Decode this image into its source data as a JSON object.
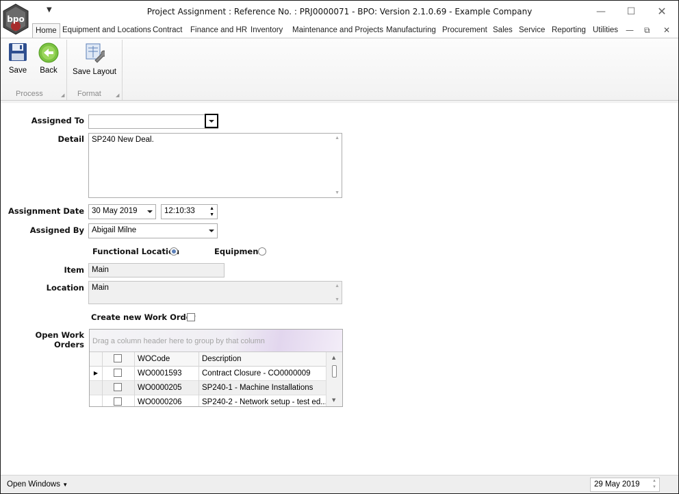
{
  "window": {
    "title": "Project Assignment : Reference No. : PRJ0000071 - BPO: Version 2.1.0.69 - Example Company",
    "logo_text": "bpo"
  },
  "ribbon": {
    "tabs": [
      "Home",
      "Equipment and Locations",
      "Contract",
      "Finance and HR",
      "Inventory",
      "Maintenance and Projects",
      "Manufacturing",
      "Procurement",
      "Sales",
      "Service",
      "Reporting",
      "Utilities"
    ],
    "active_tab": "Home",
    "save_label": "Save",
    "back_label": "Back",
    "save_layout_label": "Save Layout",
    "group_process": "Process",
    "group_format": "Format"
  },
  "form": {
    "assigned_to_label": "Assigned To",
    "assigned_to_value": "",
    "detail_label": "Detail",
    "detail_value": "SP240 New Deal.",
    "assignment_date_label": "Assignment Date",
    "assignment_date_value": "30 May 2019",
    "assignment_time_value": "12:10:33",
    "assigned_by_label": "Assigned By",
    "assigned_by_value": "Abigail Milne",
    "functional_location_label": "Functional Location",
    "equipment_label": "Equipment",
    "selected_option": "Functional Location",
    "item_label": "Item",
    "item_value": "Main",
    "location_label": "Location",
    "location_value": "Main",
    "create_wo_label": "Create new Work Order",
    "create_wo_checked": false,
    "open_wo_label": "Open Work Orders"
  },
  "grid": {
    "group_panel_text": "Drag a column header here to group by that column",
    "columns": [
      "WOCode",
      "Description"
    ],
    "rows": [
      {
        "code": "WO0001593",
        "description": "Contract Closure - CO0000009"
      },
      {
        "code": "WO0000205",
        "description": "SP240-1 - Machine Installations"
      },
      {
        "code": "WO0000206",
        "description": "SP240-2 - Network setup - test ed..."
      }
    ]
  },
  "statusbar": {
    "open_windows_label": "Open Windows",
    "date_value": "29 May 2019"
  }
}
